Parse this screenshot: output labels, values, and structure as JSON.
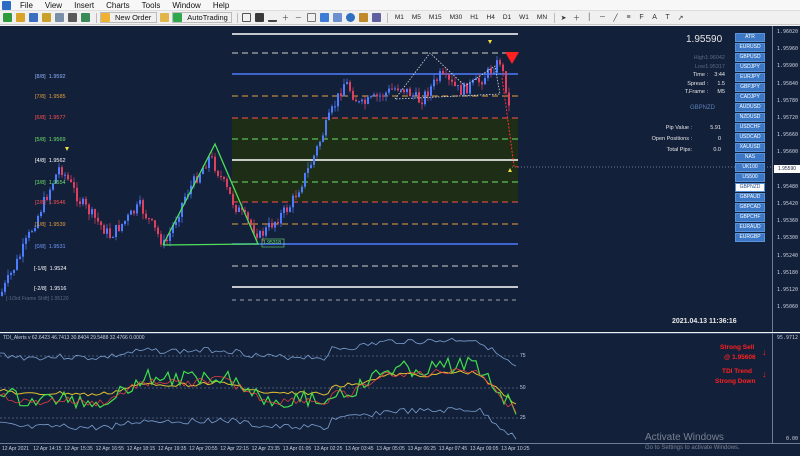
{
  "menu": [
    "File",
    "View",
    "Insert",
    "Charts",
    "Tools",
    "Window",
    "Help"
  ],
  "toolbar": {
    "new_order": "New Order",
    "auto_trading": "AutoTrading",
    "timeframes": [
      "M1",
      "M5",
      "M15",
      "M30",
      "H1",
      "H4",
      "D1",
      "W1",
      "MN"
    ]
  },
  "levels": [
    {
      "label": "[8/8]",
      "price": "1.9592",
      "color": "#8fb3ff"
    },
    {
      "label": "[7/8]",
      "price": "1.9585",
      "color": "#e0a040"
    },
    {
      "label": "[6/8]",
      "price": "1.9577",
      "color": "#ff5050"
    },
    {
      "label": "[5/8]",
      "price": "1.9569",
      "color": "#6ee06e"
    },
    {
      "label": "[4/8]",
      "price": "1.9562",
      "color": "#ffffff"
    },
    {
      "label": "[3/8]",
      "price": "1.9554",
      "color": "#6ee06e"
    },
    {
      "label": "[2/8]",
      "price": "1.9546",
      "color": "#ff5050"
    },
    {
      "label": "[1/8]",
      "price": "1.9539",
      "color": "#e0a040"
    },
    {
      "label": "[0/8]",
      "price": "1.9531",
      "color": "#6f9bff"
    },
    {
      "label": "[-1/8]",
      "price": "1.9524",
      "color": "#ffffff"
    },
    {
      "label": "[-2/8]",
      "price": "1.9516",
      "color": "#ffffff"
    }
  ],
  "frame_note": "[-1/3rd Frame Shift]   1.95120",
  "low_box_label": "1.95318",
  "info": {
    "price": "1.95590",
    "high_label": "High :",
    "high": "1.96042",
    "low_label": "Low :",
    "low": "1.95317",
    "time_label": "Time :",
    "time": "3:44",
    "spread_label": "Spread :",
    "spread": "1.5",
    "tframe_label": "T.Frame :",
    "tframe": "M5",
    "symbol": "GBPNZD",
    "pip_label": "Pip Value :",
    "pip": "5.91",
    "open_label": "Open Positions :",
    "open": "0",
    "total_label": "Total Pips:",
    "total": "0.0",
    "datetime": "2021.04.13 11:36:16"
  },
  "symbols": [
    "ATR",
    "EURUSD",
    "GBPUSD",
    "USDJPY",
    "EURJPY",
    "GBPJPY",
    "CADJPY",
    "AUDUSD",
    "NZDUSD",
    "USDCHF",
    "USDCAD",
    "XAUUSD",
    "NAS",
    "UK100",
    "US500",
    "GBPNZD",
    "GBPAUD",
    "GBPCAD",
    "GBPCHF",
    "EURAUD",
    "EURGBP"
  ],
  "active_symbol": "GBPNZD",
  "indicator": {
    "title": "TDI_Alerts v 62.6423 46.7413 30.8404 29.5488 32.4766 0.0000",
    "signal1": "Strong Sell",
    "signal2": "@ 1.95606",
    "signal3": "TDI Trend",
    "signal4": "Strong Down",
    "levels": [
      "75",
      "50",
      "25"
    ]
  },
  "price_axis": [
    "1.96020",
    "1.95960",
    "1.95900",
    "1.95840",
    "1.95780",
    "1.95720",
    "1.95660",
    "1.95600",
    "1.95540",
    "1.95480",
    "1.95420",
    "1.95360",
    "1.95300",
    "1.95240",
    "1.95180",
    "1.95120",
    "1.95060"
  ],
  "price_badge": "1.95590",
  "ind_axis": [
    "95.9712",
    "0.00"
  ],
  "time_axis": [
    "12 Apr 2021",
    "12 Apr 14:15",
    "12 Apr 15:35",
    "12 Apr 16:55",
    "12 Apr 18:15",
    "12 Apr 19:35",
    "12 Apr 20:55",
    "12 Apr 22:15",
    "12 Apr 23:35",
    "13 Apr 01:05",
    "13 Apr 02:25",
    "13 Apr 03:45",
    "13 Apr 05:05",
    "13 Apr 06:25",
    "13 Apr 07:45",
    "13 Apr 09:05",
    "13 Apr 10:25"
  ],
  "watermark": {
    "title": "Activate Windows",
    "sub": "Go to Settings to activate Windows."
  }
}
